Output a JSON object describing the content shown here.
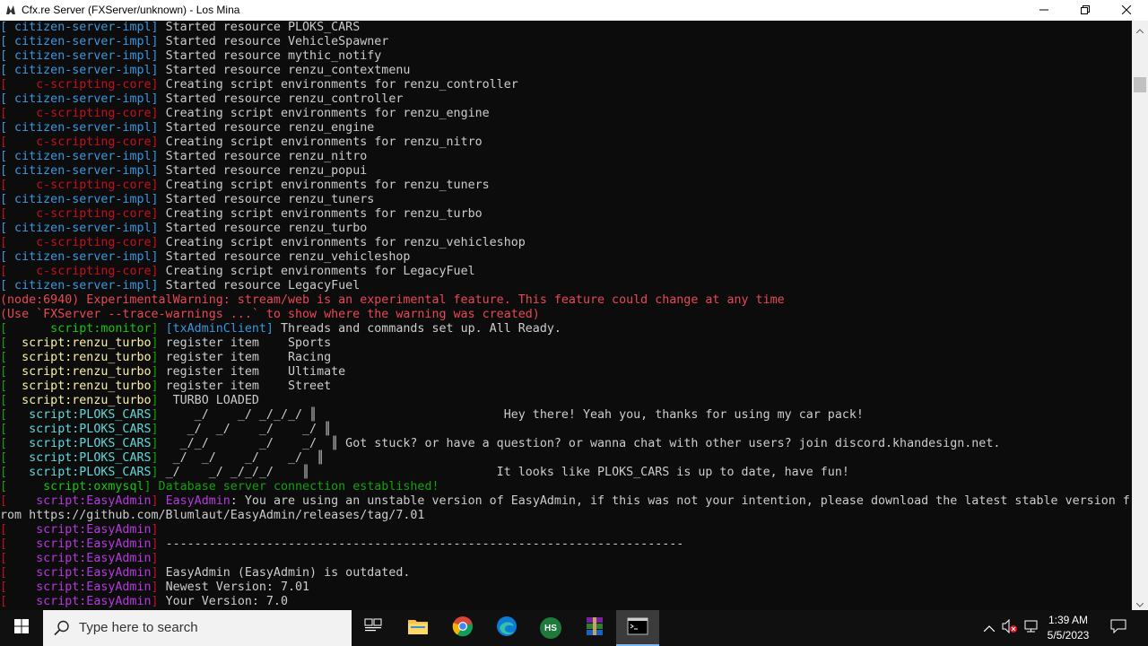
{
  "window": {
    "title": "Cfx.re Server (FXServer/unknown) - Los Mina",
    "icon": "fivem-icon"
  },
  "console_lines": [
    {
      "prefix": "[ citizen-server-impl]",
      "prefix_kind": "impl",
      "message": " Started resource PLOKS_CARS"
    },
    {
      "prefix": "[ citizen-server-impl]",
      "prefix_kind": "impl",
      "message": " Started resource VehicleSpawner"
    },
    {
      "prefix": "[ citizen-server-impl]",
      "prefix_kind": "impl",
      "message": " Started resource mythic_notify"
    },
    {
      "prefix": "[ citizen-server-impl]",
      "prefix_kind": "impl",
      "message": " Started resource renzu_contextmenu"
    },
    {
      "prefix": "[    c-scripting-core]",
      "prefix_kind": "core",
      "message": " Creating script environments for renzu_controller"
    },
    {
      "prefix": "[ citizen-server-impl]",
      "prefix_kind": "impl",
      "message": " Started resource renzu_controller"
    },
    {
      "prefix": "[    c-scripting-core]",
      "prefix_kind": "core",
      "message": " Creating script environments for renzu_engine"
    },
    {
      "prefix": "[ citizen-server-impl]",
      "prefix_kind": "impl",
      "message": " Started resource renzu_engine"
    },
    {
      "prefix": "[    c-scripting-core]",
      "prefix_kind": "core",
      "message": " Creating script environments for renzu_nitro"
    },
    {
      "prefix": "[ citizen-server-impl]",
      "prefix_kind": "impl",
      "message": " Started resource renzu_nitro"
    },
    {
      "prefix": "[ citizen-server-impl]",
      "prefix_kind": "impl",
      "message": " Started resource renzu_popui"
    },
    {
      "prefix": "[    c-scripting-core]",
      "prefix_kind": "core",
      "message": " Creating script environments for renzu_tuners"
    },
    {
      "prefix": "[ citizen-server-impl]",
      "prefix_kind": "impl",
      "message": " Started resource renzu_tuners"
    },
    {
      "prefix": "[    c-scripting-core]",
      "prefix_kind": "core",
      "message": " Creating script environments for renzu_turbo"
    },
    {
      "prefix": "[ citizen-server-impl]",
      "prefix_kind": "impl",
      "message": " Started resource renzu_turbo"
    },
    {
      "prefix": "[    c-scripting-core]",
      "prefix_kind": "core",
      "message": " Creating script environments for renzu_vehicleshop"
    },
    {
      "prefix": "[ citizen-server-impl]",
      "prefix_kind": "impl",
      "message": " Started resource renzu_vehicleshop"
    },
    {
      "prefix": "[    c-scripting-core]",
      "prefix_kind": "core",
      "message": " Creating script environments for LegacyFuel"
    },
    {
      "prefix": "[ citizen-server-impl]",
      "prefix_kind": "impl",
      "message": " Started resource LegacyFuel"
    },
    {
      "prefix": "",
      "prefix_kind": "none",
      "message": "(node:6940) ExperimentalWarning: stream/web is an experimental feature. This feature could change at any time",
      "message_kind": "warn"
    },
    {
      "prefix": "",
      "prefix_kind": "none",
      "message": "(Use `FXServer --trace-warnings ...` to show where the warning was created)",
      "message_kind": "warn"
    },
    {
      "prefix": "[      script:monitor]",
      "prefix_kind": "monitor",
      "tag": " [txAdminClient]",
      "message": " Threads and commands set up. All Ready."
    },
    {
      "prefix": "[  script:renzu_turbo]",
      "prefix_kind": "turbo",
      "message": " register item    Sports"
    },
    {
      "prefix": "[  script:renzu_turbo]",
      "prefix_kind": "turbo",
      "message": " register item    Racing"
    },
    {
      "prefix": "[  script:renzu_turbo]",
      "prefix_kind": "turbo",
      "message": " register item    Ultimate"
    },
    {
      "prefix": "[  script:renzu_turbo]",
      "prefix_kind": "turbo",
      "message": " register item    Street"
    },
    {
      "prefix": "[  script:renzu_turbo]",
      "prefix_kind": "turbo",
      "message": "  TURBO LOADED"
    },
    {
      "prefix": "[   script:PLOKS_CARS]",
      "prefix_kind": "ploks",
      "message": "     _/    _/ _/_/_/ ║                          Hey there! Yeah you, thanks for using my car pack!"
    },
    {
      "prefix": "[   script:PLOKS_CARS]",
      "prefix_kind": "ploks",
      "message": "    _/  _/    _/    _/ ║"
    },
    {
      "prefix": "[   script:PLOKS_CARS]",
      "prefix_kind": "ploks",
      "message": "   _/_/       _/    _/  ║ Got stuck? or have a question? or wanna chat with other users? join discord.khandesign.net."
    },
    {
      "prefix": "[   script:PLOKS_CARS]",
      "prefix_kind": "ploks",
      "message": "  _/  _/    _/    _/  ║"
    },
    {
      "prefix": "[   script:PLOKS_CARS]",
      "prefix_kind": "ploks",
      "message": " _/    _/ _/_/_/    ║                          It looks like PLOKS_CARS is up to date, have fun!"
    },
    {
      "prefix": "[     script:oxmysql]",
      "prefix_kind": "oxmysql",
      "message": " Database server connection established!",
      "message_kind": "green"
    },
    {
      "prefix": "[    script:EasyAdmin]",
      "prefix_kind": "admin",
      "tag_admin": " EasyAdmin",
      "message": ": You are using an unstable version of EasyAdmin, if this was not your intention, please download the latest stable version f"
    },
    {
      "prefix": "",
      "prefix_kind": "none",
      "message": "rom https://github.com/Blumlaut/EasyAdmin/releases/tag/7.01"
    },
    {
      "prefix": "[    script:EasyAdmin]",
      "prefix_kind": "admin",
      "message": ""
    },
    {
      "prefix": "[    script:EasyAdmin]",
      "prefix_kind": "admin",
      "message": " ------------------------------------------------------------------------"
    },
    {
      "prefix": "[    script:EasyAdmin]",
      "prefix_kind": "admin",
      "message": ""
    },
    {
      "prefix": "[    script:EasyAdmin]",
      "prefix_kind": "admin",
      "message": " EasyAdmin (EasyAdmin) is outdated."
    },
    {
      "prefix": "[    script:EasyAdmin]",
      "prefix_kind": "admin",
      "message": " Newest Version: 7.01"
    },
    {
      "prefix": "[    script:EasyAdmin]",
      "prefix_kind": "admin",
      "message": " Your Version: 7.0"
    }
  ],
  "taskbar": {
    "search_placeholder": "Type here to search",
    "apps": [
      "task-view-icon",
      "file-explorer-icon",
      "chrome-icon",
      "edge-icon",
      "hs-app-icon",
      "winrar-icon",
      "terminal-icon"
    ],
    "hs_label": "HS",
    "time": "1:39 AM",
    "date": "5/5/2023"
  },
  "colors": {
    "impl": "#3a96dd",
    "core": "#c50f1f",
    "admin": "#b638e0",
    "green": "#13a10e",
    "warn": "#e74856",
    "text": "#cccccc"
  }
}
